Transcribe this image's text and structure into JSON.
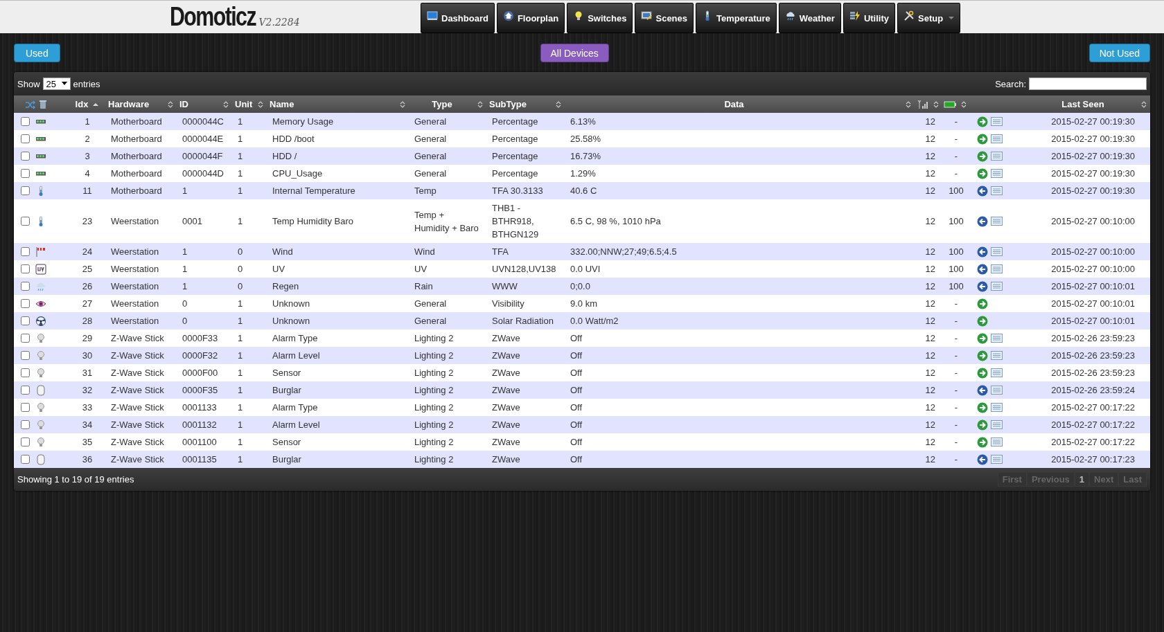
{
  "header": {
    "title": "Domoticz",
    "version": "V2.2284"
  },
  "nav": [
    {
      "label": "Dashboard",
      "kind": "dashboard",
      "menu": false
    },
    {
      "label": "Floorplan",
      "kind": "floorplan",
      "menu": false
    },
    {
      "label": "Switches",
      "kind": "bulb",
      "menu": false
    },
    {
      "label": "Scenes",
      "kind": "scenes",
      "menu": false
    },
    {
      "label": "Temperature",
      "kind": "thermometer",
      "menu": false
    },
    {
      "label": "Weather",
      "kind": "weather",
      "menu": false
    },
    {
      "label": "Utility",
      "kind": "utility",
      "menu": false
    },
    {
      "label": "Setup",
      "kind": "setup",
      "menu": true
    }
  ],
  "filters": [
    {
      "label": "Used",
      "color": "#2e9fd6"
    },
    {
      "label": "All Devices",
      "color": "#8a5cc0"
    },
    {
      "label": "Not Used",
      "color": "#2e9fd6"
    }
  ],
  "table_controls": {
    "show_label": "Show",
    "page_size": "25",
    "entries_label": "entries",
    "search_label": "Search:"
  },
  "table": {
    "columns": [
      {
        "kind": "icons"
      },
      {
        "kind": "text",
        "label": "Idx",
        "sorted": true
      },
      {
        "kind": "text",
        "label": "Hardware",
        "sorted": false
      },
      {
        "kind": "text",
        "label": "ID",
        "sorted": false
      },
      {
        "kind": "text",
        "label": "Unit",
        "sorted": false
      },
      {
        "kind": "text",
        "label": "Name",
        "sorted": false
      },
      {
        "kind": "text",
        "label": "Type",
        "sorted": false
      },
      {
        "kind": "text",
        "label": "SubType",
        "sorted": false
      },
      {
        "kind": "text",
        "label": "Data",
        "sorted": false
      },
      {
        "kind": "signal",
        "sorted": false
      },
      {
        "kind": "battery",
        "sorted": false
      },
      {
        "kind": "blank"
      },
      {
        "kind": "text",
        "label": "Last Seen",
        "sorted": false
      }
    ],
    "rows": [
      {
        "checked": false,
        "kind": "hardware",
        "idx": "1",
        "hardware": "Motherboard",
        "id": "0000044C",
        "unit": "1",
        "name": "Memory Usage",
        "type": "General",
        "subtype": "Percentage",
        "data": "6.13%",
        "signal": "12",
        "battery": "-",
        "used": false,
        "log": true,
        "last_seen": "2015-02-27 00:19:30"
      },
      {
        "checked": false,
        "kind": "hardware",
        "idx": "2",
        "hardware": "Motherboard",
        "id": "0000044E",
        "unit": "1",
        "name": "HDD /boot",
        "type": "General",
        "subtype": "Percentage",
        "data": "25.58%",
        "signal": "12",
        "battery": "-",
        "used": false,
        "log": true,
        "last_seen": "2015-02-27 00:19:30"
      },
      {
        "checked": false,
        "kind": "hardware",
        "idx": "3",
        "hardware": "Motherboard",
        "id": "0000044F",
        "unit": "1",
        "name": "HDD /",
        "type": "General",
        "subtype": "Percentage",
        "data": "16.73%",
        "signal": "12",
        "battery": "-",
        "used": false,
        "log": true,
        "last_seen": "2015-02-27 00:19:30"
      },
      {
        "checked": false,
        "kind": "hardware",
        "idx": "4",
        "hardware": "Motherboard",
        "id": "0000044D",
        "unit": "1",
        "name": "CPU_Usage",
        "type": "General",
        "subtype": "Percentage",
        "data": "1.29%",
        "signal": "12",
        "battery": "-",
        "used": false,
        "log": true,
        "last_seen": "2015-02-27 00:19:30"
      },
      {
        "checked": false,
        "kind": "thermometer",
        "idx": "11",
        "hardware": "Motherboard",
        "id": "1",
        "unit": "1",
        "name": "Internal Temperature",
        "type": "Temp",
        "subtype": "TFA 30.3133",
        "data": "40.6 C",
        "signal": "12",
        "battery": "100",
        "used": true,
        "log": true,
        "last_seen": "2015-02-27 00:19:30"
      },
      {
        "checked": false,
        "kind": "thermometer",
        "idx": "23",
        "hardware": "Weerstation",
        "id": "0001",
        "unit": "1",
        "name": "Temp Humidity Baro",
        "type": "Temp + Humidity + Baro",
        "subtype": "THB1 - BTHR918, BTHGN129",
        "data": "6.5 C, 98 %, 1010 hPa",
        "signal": "12",
        "battery": "100",
        "used": true,
        "log": true,
        "last_seen": "2015-02-27 00:10:00"
      },
      {
        "checked": false,
        "kind": "wind",
        "idx": "24",
        "hardware": "Weerstation",
        "id": "1",
        "unit": "0",
        "name": "Wind",
        "type": "Wind",
        "subtype": "TFA",
        "data": "332.00;NNW;27;49;6.5;4.5",
        "signal": "12",
        "battery": "100",
        "used": true,
        "log": true,
        "last_seen": "2015-02-27 00:10:00"
      },
      {
        "checked": false,
        "kind": "uv",
        "idx": "25",
        "hardware": "Weerstation",
        "id": "1",
        "unit": "0",
        "name": "UV",
        "type": "UV",
        "subtype": "UVN128,UV138",
        "data": "0.0 UVI",
        "signal": "12",
        "battery": "100",
        "used": true,
        "log": true,
        "last_seen": "2015-02-27 00:10:00"
      },
      {
        "checked": false,
        "kind": "rain",
        "idx": "26",
        "hardware": "Weerstation",
        "id": "1",
        "unit": "0",
        "name": "Regen",
        "type": "Rain",
        "subtype": "WWW",
        "data": "0;0.0",
        "signal": "12",
        "battery": "100",
        "used": true,
        "log": true,
        "last_seen": "2015-02-27 00:10:01"
      },
      {
        "checked": false,
        "kind": "eye",
        "idx": "27",
        "hardware": "Weerstation",
        "id": "0",
        "unit": "1",
        "name": "Unknown",
        "type": "General",
        "subtype": "Visibility",
        "data": "9.0 km",
        "signal": "12",
        "battery": "-",
        "used": false,
        "log": false,
        "last_seen": "2015-02-27 00:10:01"
      },
      {
        "checked": false,
        "kind": "radiation",
        "idx": "28",
        "hardware": "Weerstation",
        "id": "0",
        "unit": "1",
        "name": "Unknown",
        "type": "General",
        "subtype": "Solar Radiation",
        "data": "0.0 Watt/m2",
        "signal": "12",
        "battery": "-",
        "used": false,
        "log": false,
        "last_seen": "2015-02-27 00:10:01"
      },
      {
        "checked": false,
        "kind": "bulb",
        "idx": "29",
        "hardware": "Z-Wave Stick",
        "id": "0000F33",
        "unit": "1",
        "name": "Alarm Type",
        "type": "Lighting 2",
        "subtype": "ZWave",
        "data": "Off",
        "signal": "12",
        "battery": "-",
        "used": false,
        "log": true,
        "last_seen": "2015-02-26 23:59:23"
      },
      {
        "checked": false,
        "kind": "bulb",
        "idx": "30",
        "hardware": "Z-Wave Stick",
        "id": "0000F32",
        "unit": "1",
        "name": "Alarm Level",
        "type": "Lighting 2",
        "subtype": "ZWave",
        "data": "Off",
        "signal": "12",
        "battery": "-",
        "used": false,
        "log": true,
        "last_seen": "2015-02-26 23:59:23"
      },
      {
        "checked": false,
        "kind": "bulb",
        "idx": "31",
        "hardware": "Z-Wave Stick",
        "id": "0000F00",
        "unit": "1",
        "name": "Sensor",
        "type": "Lighting 2",
        "subtype": "ZWave",
        "data": "Off",
        "signal": "12",
        "battery": "-",
        "used": false,
        "log": true,
        "last_seen": "2015-02-26 23:59:23"
      },
      {
        "checked": false,
        "kind": "door",
        "idx": "32",
        "hardware": "Z-Wave Stick",
        "id": "0000F35",
        "unit": "1",
        "name": "Burglar",
        "type": "Lighting 2",
        "subtype": "ZWave",
        "data": "Off",
        "signal": "12",
        "battery": "-",
        "used": true,
        "log": true,
        "last_seen": "2015-02-26 23:59:24"
      },
      {
        "checked": false,
        "kind": "bulb",
        "idx": "33",
        "hardware": "Z-Wave Stick",
        "id": "0001133",
        "unit": "1",
        "name": "Alarm Type",
        "type": "Lighting 2",
        "subtype": "ZWave",
        "data": "Off",
        "signal": "12",
        "battery": "-",
        "used": false,
        "log": true,
        "last_seen": "2015-02-27 00:17:22"
      },
      {
        "checked": false,
        "kind": "bulb",
        "idx": "34",
        "hardware": "Z-Wave Stick",
        "id": "0001132",
        "unit": "1",
        "name": "Alarm Level",
        "type": "Lighting 2",
        "subtype": "ZWave",
        "data": "Off",
        "signal": "12",
        "battery": "-",
        "used": false,
        "log": true,
        "last_seen": "2015-02-27 00:17:22"
      },
      {
        "checked": false,
        "kind": "bulb",
        "idx": "35",
        "hardware": "Z-Wave Stick",
        "id": "0001100",
        "unit": "1",
        "name": "Sensor",
        "type": "Lighting 2",
        "subtype": "ZWave",
        "data": "Off",
        "signal": "12",
        "battery": "-",
        "used": false,
        "log": true,
        "last_seen": "2015-02-27 00:17:22"
      },
      {
        "checked": false,
        "kind": "door",
        "idx": "36",
        "hardware": "Z-Wave Stick",
        "id": "0001135",
        "unit": "1",
        "name": "Burglar",
        "type": "Lighting 2",
        "subtype": "ZWave",
        "data": "Off",
        "signal": "12",
        "battery": "-",
        "used": true,
        "log": true,
        "last_seen": "2015-02-27 00:17:23"
      }
    ]
  },
  "footer": {
    "info": "Showing 1 to 19 of 19 entries",
    "pagination": [
      {
        "label": "First",
        "disabled": true
      },
      {
        "label": "Previous",
        "disabled": true
      },
      {
        "label": "1",
        "disabled": false
      },
      {
        "label": "Next",
        "disabled": true
      },
      {
        "label": "Last",
        "disabled": true
      }
    ]
  }
}
